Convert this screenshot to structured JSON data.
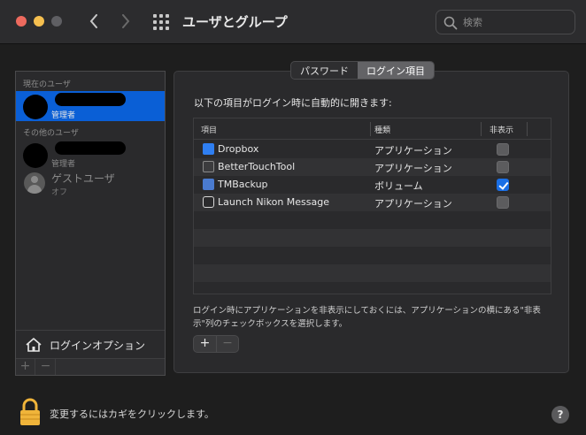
{
  "window": {
    "title": "ユーザとグループ",
    "search_placeholder": "検索"
  },
  "sidebar": {
    "current_section": "現在のユーザ",
    "current_user": {
      "role": "管理者"
    },
    "other_section": "その他のユーザ",
    "other_user": {
      "role": "管理者"
    },
    "guest": {
      "name": "ゲストユーザ",
      "status": "オフ"
    },
    "login_options": "ログインオプション",
    "add": "+",
    "remove": "−"
  },
  "tabs": [
    {
      "label": "パスワード",
      "selected": false
    },
    {
      "label": "ログイン項目",
      "selected": true
    }
  ],
  "main": {
    "intro": "以下の項目がログイン時に自動的に開きます:",
    "columns": [
      "項目",
      "種類",
      "非表示"
    ],
    "items": [
      {
        "name": "Dropbox",
        "kind": "アプリケーション",
        "hidden": false,
        "icon": "dropbox-icon",
        "icon_color": "#2f7ff2"
      },
      {
        "name": "BetterTouchTool",
        "kind": "アプリケーション",
        "hidden": false,
        "icon": "bettertouchtool-icon",
        "icon_color": "#555555"
      },
      {
        "name": "TMBackup",
        "kind": "ボリューム",
        "hidden": true,
        "icon": "volume-icon",
        "icon_color": "#4a7bd0"
      },
      {
        "name": "Launch Nikon Message",
        "kind": "アプリケーション",
        "hidden": false,
        "icon": "message-icon",
        "icon_color": "#d8d8d8"
      }
    ],
    "note": "ログイン時にアプリケーションを非表示にしておくには、アプリケーションの横にある\"非表示\"列のチェックボックスを選択します。",
    "add": "+",
    "remove": "−"
  },
  "footer": {
    "lock_text": "変更するにはカギをクリックします。",
    "help": "?"
  },
  "colors": {
    "accent": "#0a5fd6",
    "checkbox_on": "#1a6fe6"
  }
}
